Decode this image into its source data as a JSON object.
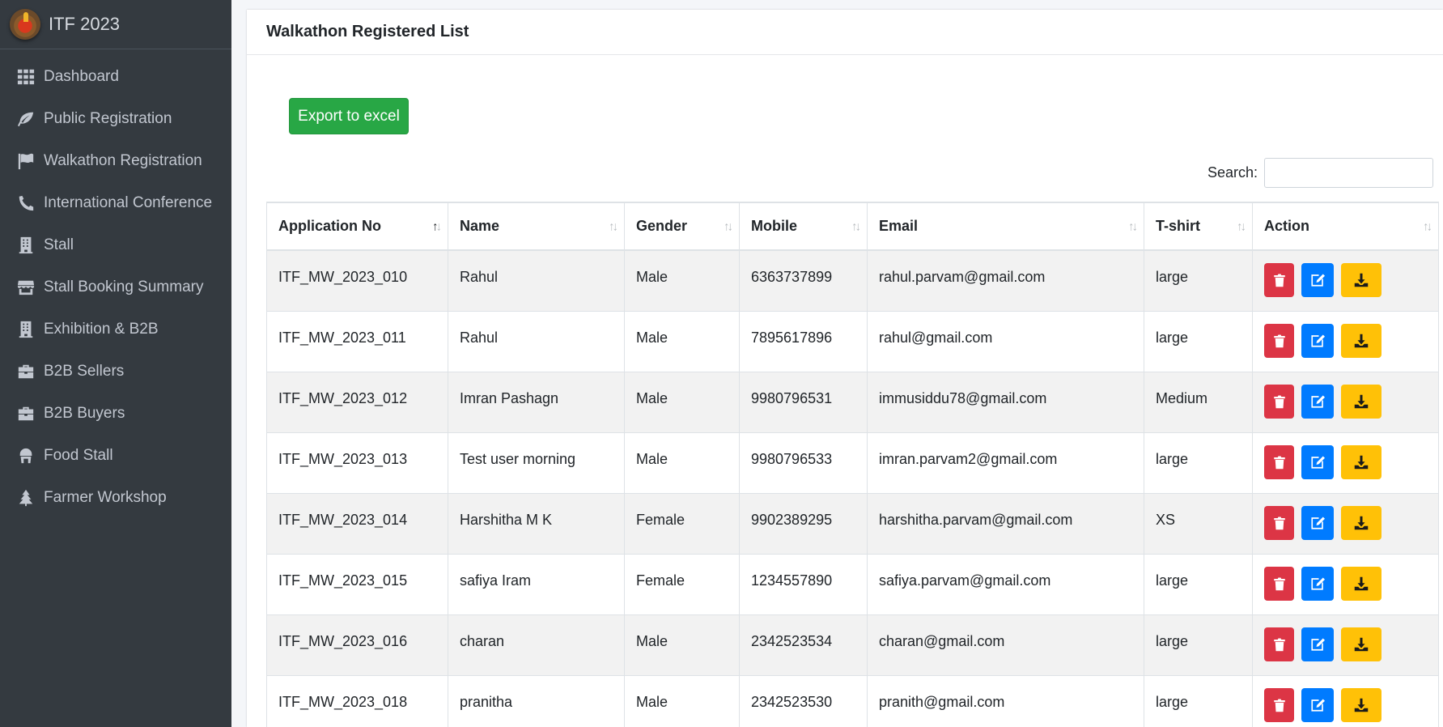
{
  "app": {
    "title": "ITF 2023"
  },
  "sidebar": {
    "items": [
      {
        "label": "Dashboard",
        "icon": "grid-icon"
      },
      {
        "label": "Public Registration",
        "icon": "leaf-icon"
      },
      {
        "label": "Walkathon Registration",
        "icon": "flag-icon"
      },
      {
        "label": "International Conference",
        "icon": "phone-icon"
      },
      {
        "label": "Stall",
        "icon": "building-icon"
      },
      {
        "label": "Stall Booking Summary",
        "icon": "store-icon"
      },
      {
        "label": "Exhibition & B2B",
        "icon": "building-icon"
      },
      {
        "label": "B2B Sellers",
        "icon": "briefcase-icon"
      },
      {
        "label": "B2B Buyers",
        "icon": "briefcase-icon"
      },
      {
        "label": "Food Stall",
        "icon": "utensils-icon"
      },
      {
        "label": "Farmer Workshop",
        "icon": "tree-icon"
      }
    ]
  },
  "main": {
    "title": "Walkathon Registered List",
    "export_label": "Export to excel",
    "search_label": "Search:",
    "search_value": "",
    "columns": [
      "Application No",
      "Name",
      "Gender",
      "Mobile",
      "Email",
      "T-shirt",
      "Action"
    ],
    "sorted_column": "Application No",
    "rows": [
      {
        "app_no": "ITF_MW_2023_010",
        "name": "Rahul",
        "gender": "Male",
        "mobile": "6363737899",
        "email": "rahul.parvam@gmail.com",
        "tshirt": "large"
      },
      {
        "app_no": "ITF_MW_2023_011",
        "name": "Rahul",
        "gender": "Male",
        "mobile": "7895617896",
        "email": "rahul@gmail.com",
        "tshirt": "large"
      },
      {
        "app_no": "ITF_MW_2023_012",
        "name": "Imran Pashagn",
        "gender": "Male",
        "mobile": "9980796531",
        "email": "immusiddu78@gmail.com",
        "tshirt": "Medium"
      },
      {
        "app_no": "ITF_MW_2023_013",
        "name": "Test user morning",
        "gender": "Male",
        "mobile": "9980796533",
        "email": "imran.parvam2@gmail.com",
        "tshirt": "large"
      },
      {
        "app_no": "ITF_MW_2023_014",
        "name": "Harshitha M K",
        "gender": "Female",
        "mobile": "9902389295",
        "email": "harshitha.parvam@gmail.com",
        "tshirt": "XS"
      },
      {
        "app_no": "ITF_MW_2023_015",
        "name": "safiya Iram",
        "gender": "Female",
        "mobile": "1234557890",
        "email": "safiya.parvam@gmail.com",
        "tshirt": "large"
      },
      {
        "app_no": "ITF_MW_2023_016",
        "name": "charan",
        "gender": "Male",
        "mobile": "2342523534",
        "email": "charan@gmail.com",
        "tshirt": "large"
      },
      {
        "app_no": "ITF_MW_2023_018",
        "name": "pranitha",
        "gender": "Male",
        "mobile": "2342523530",
        "email": "pranith@gmail.com",
        "tshirt": "large"
      }
    ]
  },
  "colors": {
    "sidebar_bg": "#343a40",
    "export": "#28a745",
    "delete": "#dc3545",
    "edit": "#007bff",
    "download": "#ffc107"
  }
}
